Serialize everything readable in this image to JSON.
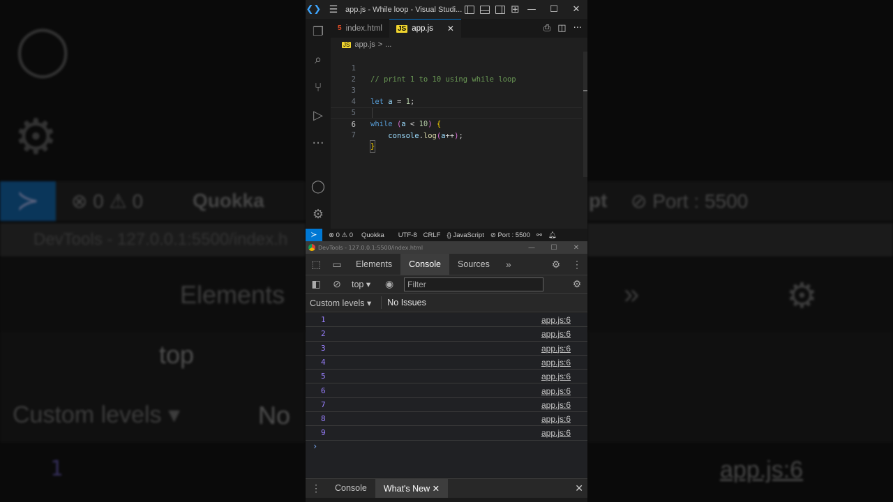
{
  "vscode": {
    "window_title": "app.js - While loop - Visual Studi...",
    "tabs": [
      {
        "label": "index.html",
        "icon": "html-file-icon"
      },
      {
        "label": "app.js",
        "icon": "js-file-icon"
      }
    ],
    "breadcrumb": {
      "file": "app.js",
      "separator": ">",
      "rest": "..."
    },
    "code_lines": [
      {
        "n": "1",
        "text": "// print 1 to 10 using while loop"
      },
      {
        "n": "2",
        "text": ""
      },
      {
        "n": "3",
        "text": "let a = 1;"
      },
      {
        "n": "4",
        "text": ""
      },
      {
        "n": "5",
        "text": "while (a < 10) {"
      },
      {
        "n": "6",
        "text": "    console.log(a++);"
      },
      {
        "n": "7",
        "text": "}"
      }
    ],
    "statusbar": {
      "errors": "0",
      "warnings": "0",
      "quokka": "Quokka",
      "encoding": "UTF-8",
      "eol": "CRLF",
      "language": "JavaScript",
      "port": "Port : 5500"
    }
  },
  "devtools": {
    "window_title": "DevTools - 127.0.0.1:5500/index.html",
    "tabs": [
      "Elements",
      "Console",
      "Sources"
    ],
    "context": "top",
    "filter_placeholder": "Filter",
    "levels": "Custom levels ▾",
    "issues": "No Issues",
    "console_rows": [
      {
        "value": "1",
        "source": "app.js:6"
      },
      {
        "value": "2",
        "source": "app.js:6"
      },
      {
        "value": "3",
        "source": "app.js:6"
      },
      {
        "value": "4",
        "source": "app.js:6"
      },
      {
        "value": "5",
        "source": "app.js:6"
      },
      {
        "value": "6",
        "source": "app.js:6"
      },
      {
        "value": "7",
        "source": "app.js:6"
      },
      {
        "value": "8",
        "source": "app.js:6"
      },
      {
        "value": "9",
        "source": "app.js:6"
      }
    ],
    "prompt": "›",
    "drawer_tabs": [
      "Console",
      "What's New"
    ]
  },
  "background": {
    "status_errors": "0",
    "status_warnings": "0",
    "quokka": "Quokka",
    "port": "Port : 5500",
    "port_fragment": "pt",
    "devtools_title": "DevTools - 127.0.0.1:5500/index.h",
    "elements": "Elements",
    "top": "top",
    "custom_levels": "Custom levels ▾",
    "no": "No",
    "row_value": "1",
    "row_source": "app.js:6"
  },
  "colors": {
    "accent": "#0078d4",
    "console_value": "#9980ff",
    "comment": "#6a9955",
    "keyword": "#569cd6"
  }
}
